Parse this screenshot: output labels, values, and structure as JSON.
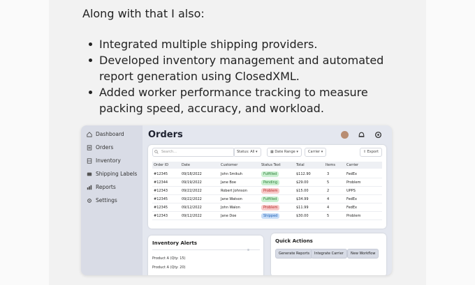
{
  "slide": {
    "intro": "Along with that I also:",
    "bullets": [
      "Integrated multiple shipping providers.",
      "Developed inventory management and automated",
      "report generation using ClosedXML.",
      "Added worker performance tracking to measure",
      "packing speed, accuracy, and workload."
    ]
  },
  "app": {
    "sidebar": {
      "items": [
        {
          "label": "Dashboard",
          "icon": "home-icon"
        },
        {
          "label": "Orders",
          "icon": "orders-icon"
        },
        {
          "label": "Inventory",
          "icon": "inventory-icon"
        },
        {
          "label": "Shipping Labels",
          "icon": "label-icon"
        },
        {
          "label": "Reports",
          "icon": "chart-icon"
        },
        {
          "label": "Settings",
          "icon": "gear-icon"
        }
      ]
    },
    "header": {
      "title": "Orders"
    },
    "toolbar": {
      "search_placeholder": "Search...",
      "status_filter": "Status: All",
      "date_filter": "Date Range",
      "carrier_filter": "Carrier",
      "export_label": "Export"
    },
    "table": {
      "columns": [
        "Order ID",
        "Date",
        "Customer",
        "Status Text",
        "Total",
        "Items",
        "Carrier"
      ],
      "rows": [
        {
          "id": "#12345",
          "date": "09/18/2022",
          "customer": "John Smikuh",
          "status": "Fulfilled",
          "total": "$112.90",
          "items": "3",
          "carrier": "FedEx"
        },
        {
          "id": "#12344",
          "date": "09/19/2022",
          "customer": "Jane Boe",
          "status": "Pending",
          "total": "$29.00",
          "items": "5",
          "carrier": "Problem"
        },
        {
          "id": "#12343",
          "date": "09/22/2022",
          "customer": "Robert Johnson",
          "status": "Problem",
          "total": "$15.00",
          "items": "2",
          "carrier": "UPPS"
        },
        {
          "id": "#12345",
          "date": "09/22/2022",
          "customer": "Jane Watson",
          "status": "Fulfilled",
          "total": "$34.99",
          "items": "4",
          "carrier": "FedEx"
        },
        {
          "id": "#12345",
          "date": "09/12/2022",
          "customer": "John Walon",
          "status": "Problem",
          "total": "$11.99",
          "items": "4",
          "carrier": "FedEx"
        },
        {
          "id": "#12343",
          "date": "09/12/2022",
          "customer": "Jane Doe",
          "status": "Shipped",
          "total": "$30.00",
          "items": "5",
          "carrier": "Problem"
        }
      ]
    },
    "alerts": {
      "title": "Inventory Alerts",
      "items": [
        "Product A (Qty: 15)",
        "Product A (Qty: 20)"
      ]
    },
    "quick_actions": {
      "title": "Quick Actions",
      "buttons": [
        "Generate Reports",
        "Integrate Carrier",
        "New Workflow"
      ]
    },
    "status_colors": {
      "Fulfilled": {
        "bg": "#c9efcf",
        "fg": "#2e7d3a"
      },
      "Pending": {
        "bg": "#c9efcf",
        "fg": "#2e7d3a"
      },
      "Problem": {
        "bg": "#f7c9c9",
        "fg": "#b32424"
      },
      "Shipped": {
        "bg": "#c6dcf7",
        "fg": "#1d5fb4"
      }
    }
  }
}
